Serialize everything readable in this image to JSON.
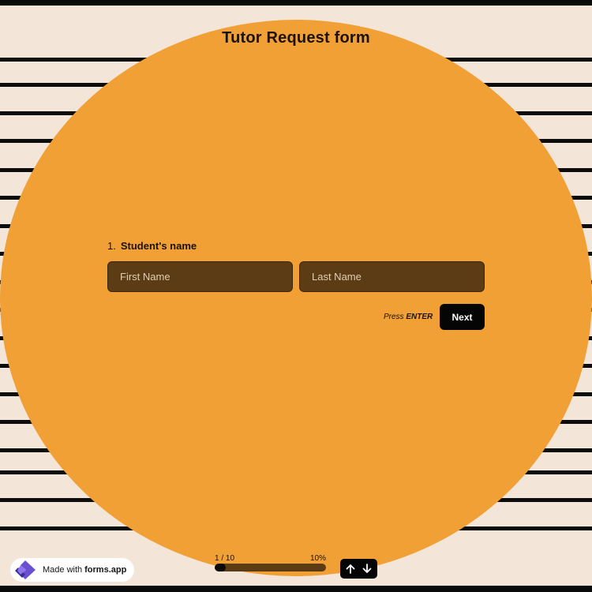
{
  "form": {
    "title": "Tutor Request form",
    "question": {
      "number": "1.",
      "text": "Student's name",
      "first_name_placeholder": "First Name",
      "last_name_placeholder": "Last Name"
    },
    "hint": {
      "prefix": "Press",
      "key": "ENTER"
    },
    "next_label": "Next"
  },
  "progress": {
    "count_label": "1 / 10",
    "percent_label": "10%",
    "percent": 10
  },
  "badge": {
    "prefix": "Made with",
    "brand": "forms.app"
  },
  "icons": {
    "logo": "forms-app-logo",
    "up": "arrow-up-icon",
    "down": "arrow-down-icon"
  },
  "colors": {
    "background": "#f3e5d8",
    "circle": "#f1a035",
    "input": "#5c3c14",
    "button": "#050505",
    "stripe": "#0d0d0d"
  }
}
